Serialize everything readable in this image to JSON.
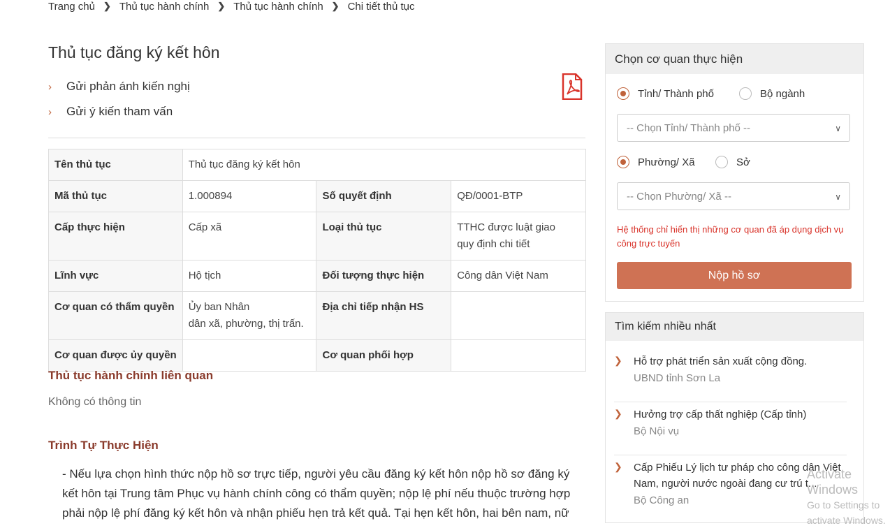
{
  "breadcrumb": [
    "Trang chủ",
    "Thủ tục hành chính",
    "Thủ tục hành chính",
    "Chi tiết thủ tục"
  ],
  "title": "Thủ tục đăng ký kết hôn",
  "actions": [
    "Gửi phản ánh kiến nghị",
    "Gửi ý kiến tham vấn"
  ],
  "info": {
    "ten_thu_tuc_label": "Tên thủ tục",
    "ten_thu_tuc": "Thủ tục đăng ký kết hôn",
    "ma_thu_tuc_label": "Mã thủ tục",
    "ma_thu_tuc": "1.000894",
    "so_quyet_dinh_label": "Số quyết định",
    "so_quyet_dinh": "QĐ/0001-BTP",
    "cap_thuc_hien_label": "Cấp thực hiện",
    "cap_thuc_hien": "Cấp xã",
    "loai_thu_tuc_label": "Loại thủ tục",
    "loai_thu_tuc_1": "TTHC được luật giao",
    "loai_thu_tuc_2": "quy định chi tiết",
    "linh_vuc_label": "Lĩnh vực",
    "linh_vuc": "Hộ tịch",
    "doi_tuong_label": "Đối tượng thực hiện",
    "doi_tuong": "Công dân Việt Nam",
    "co_quan_label": "Cơ quan có thẩm quyền",
    "co_quan_1": "Ủy ban Nhân",
    "co_quan_2": "dân xã, phường, thị trấn.",
    "dia_chi_label": "Địa chỉ tiếp nhận HS",
    "dia_chi": "",
    "uy_quyen_label": "Cơ quan được ủy quyền",
    "uy_quyen": "",
    "phoi_hop_label": "Cơ quan phối hợp",
    "phoi_hop": ""
  },
  "related_title": "Thủ tục hành chính liên quan",
  "related_empty": "Không có thông tin",
  "sequence_title": "Trình Tự Thực Hiện",
  "sequence_text": "- Nếu lựa chọn hình thức nộp hồ sơ trực tiếp, người yêu cầu đăng ký kết hôn nộp hồ sơ đăng ký kết hôn tại Trung tâm Phục vụ hành chính công có thẩm quyền; nộp lệ phí nếu thuộc trường hợp phải nộp lệ phí đăng ký kết hôn và nhận phiếu hẹn trả kết quả. Tại hẹn kết hôn, hai bên nam, nữ",
  "agency_panel": {
    "title": "Chọn cơ quan thực hiện",
    "radio1a": "Tỉnh/ Thành phố",
    "radio1b": "Bộ ngành",
    "select1": "-- Chọn Tỉnh/ Thành phố --",
    "radio2a": "Phường/ Xã",
    "radio2b": "Sở",
    "select2": "-- Chọn Phường/ Xã --",
    "note": "Hệ thống chỉ hiển thị những cơ quan đã áp dụng dịch vụ công trực tuyến",
    "submit": "Nộp hồ sơ"
  },
  "search_panel": {
    "title": "Tìm kiếm nhiều nhất",
    "items": [
      {
        "title": "Hỗ trợ phát triển sản xuất cộng đồng.",
        "org": "UBND tỉnh Sơn La"
      },
      {
        "title": "Hưởng trợ cấp thất nghiệp (Cấp tỉnh)",
        "org": "Bộ Nội vụ"
      },
      {
        "title": "Cấp Phiếu Lý lịch tư pháp cho công dân Việt Nam, người nước ngoài đang cư trú t...",
        "org": "Bộ Công an"
      }
    ]
  },
  "watermark": {
    "line1": "Activate Windows",
    "line2": "Go to Settings to activate Windows."
  },
  "colors": {
    "accent": "#cf7254",
    "section_title": "#8a3b2c",
    "note": "#d9342b"
  }
}
